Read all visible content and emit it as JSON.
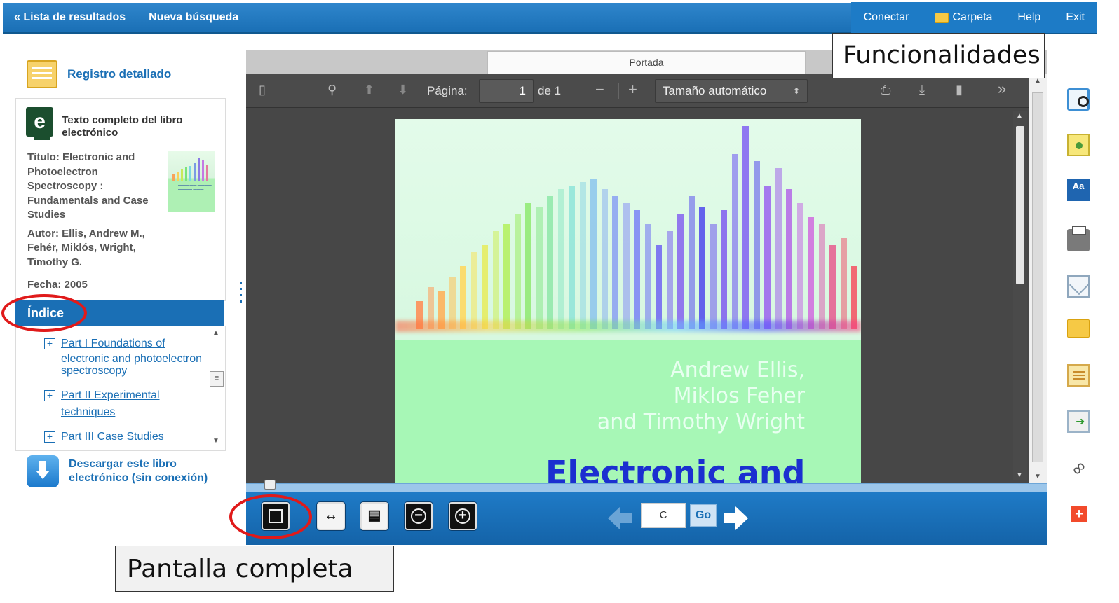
{
  "topbar": {
    "results_link": "« Lista de resultados",
    "new_search": "Nueva búsqueda",
    "connect": "Conectar",
    "folder": "Carpeta",
    "help": "Help",
    "exit": "Exit"
  },
  "sidebar": {
    "detailed_record": "Registro detallado",
    "ebook_heading": "Texto completo del libro electrónico",
    "ebook_icon_text": "e",
    "title_lines": [
      "Título: Electronic and",
      "Photoelectron",
      "Spectroscopy :",
      "Fundamentals and Case",
      "Studies"
    ],
    "author_lines": [
      "Autor: Ellis, Andrew M.,",
      "Fehér, Miklós, Wright,",
      "Timothy G."
    ],
    "date": "Fecha: 2005",
    "index_label": "Índice",
    "toc": [
      {
        "line1": "Part I Foundations of",
        "line2": "electronic and photoelectron",
        "line3": "spectroscopy"
      },
      {
        "line1": "Part II Experimental",
        "line2": "techniques"
      },
      {
        "line1": "Part III Case Studies"
      }
    ],
    "download_line1": "Descargar este libro",
    "download_line2": "electrónico (sin conexión)"
  },
  "viewer": {
    "tab_label": "Portada",
    "page_label": "Página:",
    "page_value": "1",
    "page_total": "de 1",
    "zoom_label": "Tamaño automático",
    "cover_authors": [
      "Andrew Ellis,",
      "Miklos Feher",
      "and Timothy Wright"
    ],
    "cover_title": "Electronic and",
    "goto_value": "C",
    "go_label": "Go"
  },
  "annotations": {
    "features": "Funcionalidades",
    "fullscreen": "Pantalla completa",
    "ring_color": "#e01a1a"
  },
  "colors": {
    "brand_blue": "#1a6fb5",
    "viewer_dark": "#474747",
    "cover_green": "#a7f7b6"
  }
}
